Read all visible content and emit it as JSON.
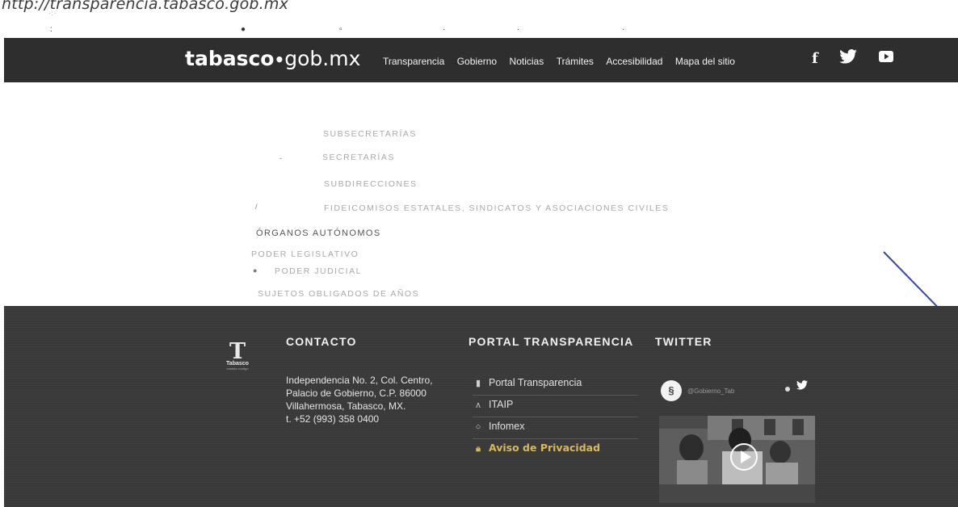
{
  "url_text": "http://transparencia.tabasco.gob.mx",
  "header": {
    "logo_bold": "tabasco",
    "logo_dot": "•",
    "logo_rest": "gob.mx",
    "nav": [
      {
        "label": "Transparencia"
      },
      {
        "label": "Gobierno"
      },
      {
        "label": "Noticias"
      },
      {
        "label": "Trámites"
      },
      {
        "label": "Accesibilidad"
      },
      {
        "label": "Mapa del sitio"
      }
    ],
    "social_icons": [
      "facebook-icon",
      "twitter-icon",
      "youtube-icon"
    ],
    "facebook_glyph": "f"
  },
  "list_items": [
    {
      "text": "SUBSECRETARÍAS"
    },
    {
      "text": "SECRETARÍAS"
    },
    {
      "text": "SUBDIRECCIONES"
    },
    {
      "text": "FIDEICOMISOS ESTATALES, SINDICATOS Y ASOCIACIONES CIVILES"
    },
    {
      "text": "ÓRGANOS AUTÓNOMOS"
    },
    {
      "text": "PODER LEGISLATIVO"
    },
    {
      "text": "PODER JUDICIAL"
    },
    {
      "text": "SUJETOS OBLIGADOS DE AÑOS"
    }
  ],
  "footer": {
    "logo": {
      "letter": "T",
      "name": "Tabasco",
      "sub": "cambia contigo"
    },
    "contact_heading": "CONTACTO",
    "contact_lines": [
      "Independencia No. 2, Col. Centro,",
      "Palacio de Gobierno, C.P. 86000",
      "Villahermosa, Tabasco, MX.",
      "t. +52 (993) 358 0400"
    ],
    "portal_heading": "PORTAL TRANSPARENCIA",
    "portal_links": [
      {
        "label": "Portal Transparencia",
        "icon": "document-icon"
      },
      {
        "label": "ITAIP",
        "icon": "itaip-icon"
      },
      {
        "label": "Infomex",
        "icon": "chat-icon"
      },
      {
        "label": "Aviso de Privacidad",
        "icon": "lock-icon"
      }
    ],
    "twitter_heading": "TWITTER",
    "twitter_handle": "@Gobierno_Tab"
  },
  "colors": {
    "nav_bg": "#2e2e2e",
    "footer_bg": "#393939",
    "privacy_link": "#d9b85a"
  }
}
